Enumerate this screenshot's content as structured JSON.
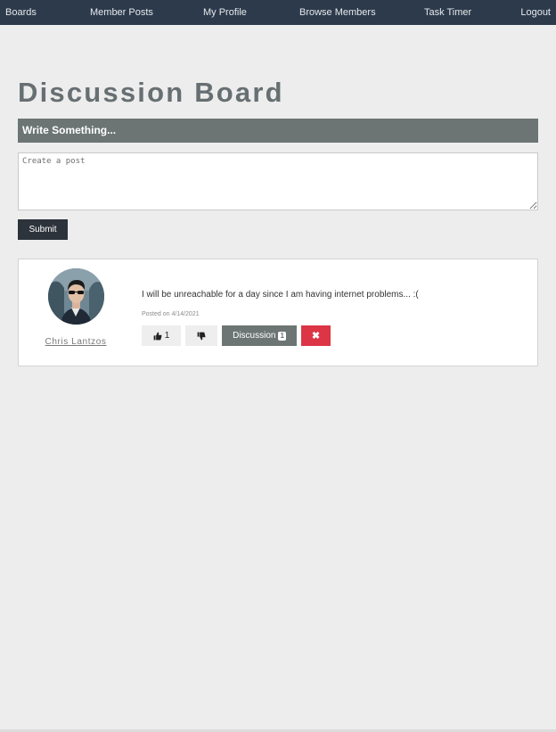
{
  "nav": {
    "boards": "Boards",
    "member_posts": "Member Posts",
    "my_profile": "My Profile",
    "browse_members": "Browse Members",
    "task_timer": "Task Timer",
    "logout": "Logout"
  },
  "page": {
    "title": "Discussion Board",
    "write_header": "Write Something...",
    "input_placeholder": "Create a post",
    "submit_label": "Submit"
  },
  "post": {
    "author": "Chris Lantzos",
    "text": "I will be unreachable for a day since I am having internet problems... :(",
    "date": "Posted on 4/14/2021",
    "like_count": "1",
    "discussion_label": "Discussion",
    "discussion_count": "1",
    "delete_label": "✖",
    "like_icon": "thumbs-up-icon",
    "dislike_icon": "thumbs-down-icon"
  },
  "colors": {
    "navbar": "#2c3a4b",
    "header_bar": "#6c7573",
    "submit": "#2c333b",
    "delete": "#dc3545",
    "background": "#ededed"
  }
}
